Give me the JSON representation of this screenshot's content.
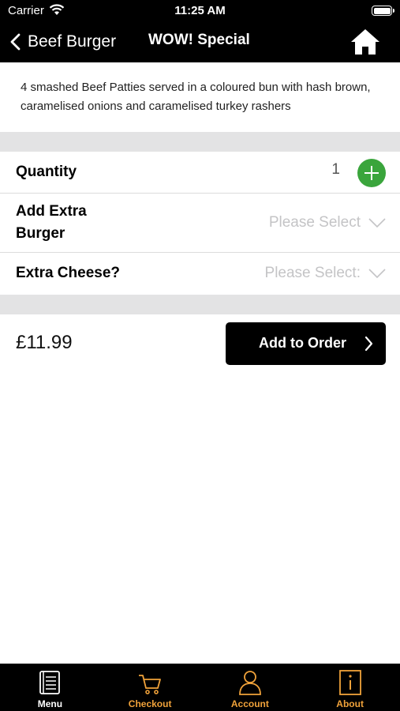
{
  "status_bar": {
    "carrier": "Carrier",
    "time": "11:25 AM"
  },
  "nav": {
    "back_label": "Beef Burger",
    "title": "WOW! Special"
  },
  "description": "4 smashed Beef Patties served in a coloured bun with  hash brown, caramelised onions and caramelised turkey rashers",
  "options": {
    "quantity_label": "Quantity",
    "quantity_value": "1",
    "extra_burger_label_line1": "Add Extra",
    "extra_burger_label_line2": "Burger",
    "extra_burger_placeholder": "Please Select",
    "extra_cheese_label": "Extra Cheese?",
    "extra_cheese_placeholder": "Please Select:"
  },
  "order": {
    "price": "£11.99",
    "add_label": "Add to Order"
  },
  "tabs": [
    {
      "label": "Menu",
      "icon": "menu-book-icon",
      "active": true
    },
    {
      "label": "Checkout",
      "icon": "cart-icon",
      "active": false
    },
    {
      "label": "Account",
      "icon": "person-icon",
      "active": false
    },
    {
      "label": "About",
      "icon": "info-icon",
      "active": false
    }
  ],
  "colors": {
    "accent": "#f0a23a",
    "primary": "#000000",
    "plus": "#3aa53c",
    "separator": "#e3e3e4"
  }
}
